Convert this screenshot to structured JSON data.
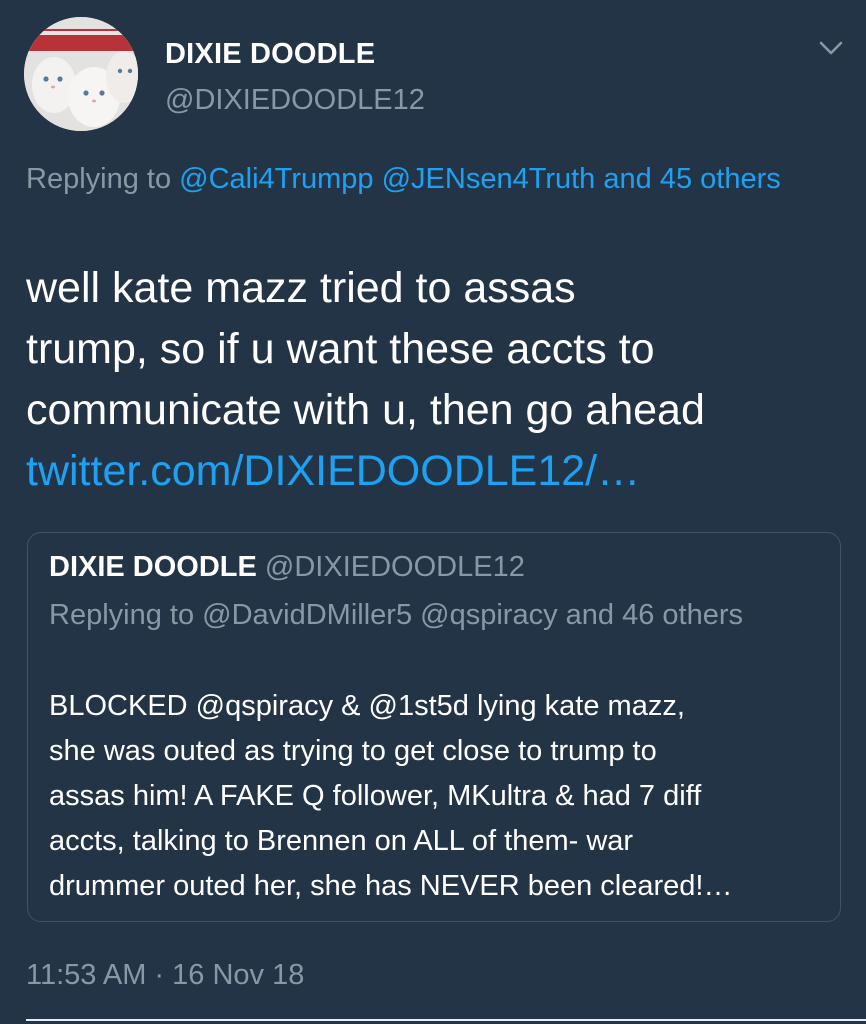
{
  "tweet": {
    "display_name": "DIXIE DOODLE",
    "handle": "@DIXIEDOODLE12",
    "reply_prefix": "Replying to ",
    "reply_mention_1": "@Cali4Trumpp",
    "reply_mention_2": "@JENsen4Truth",
    "reply_others": "and 45 others",
    "text_lines": [
      "well kate mazz tried to assas",
      "trump, so if u want these accts to",
      "communicate with u, then go ahead"
    ],
    "link": "twitter.com/DIXIEDOODLE12/…",
    "timestamp": "11:53 AM · 16 Nov 18"
  },
  "quoted_tweet": {
    "display_name": "DIXIE DOODLE",
    "handle": "@DIXIEDOODLE12",
    "reply_prefix": "Replying to ",
    "reply_mention_1": "@DavidDMiller5",
    "reply_mention_2": "@qspiracy",
    "reply_others": "and 46 others",
    "body_lines": [
      "BLOCKED @qspiracy & @1st5d lying kate mazz,",
      "she was outed as trying to get close to trump to",
      "assas him!  A FAKE Q follower, MKultra & had 7 diff",
      "accts, talking to Brennen on ALL of them- war",
      "drummer outed her, she has NEVER been cleared!…"
    ]
  },
  "icons": {
    "avatar": "cat-photo-avatar",
    "menu": "chevron-down-icon"
  },
  "colors": {
    "background": "#243447",
    "link": "#1da1f2",
    "muted": "#8899a6",
    "border": "#3d5466"
  }
}
